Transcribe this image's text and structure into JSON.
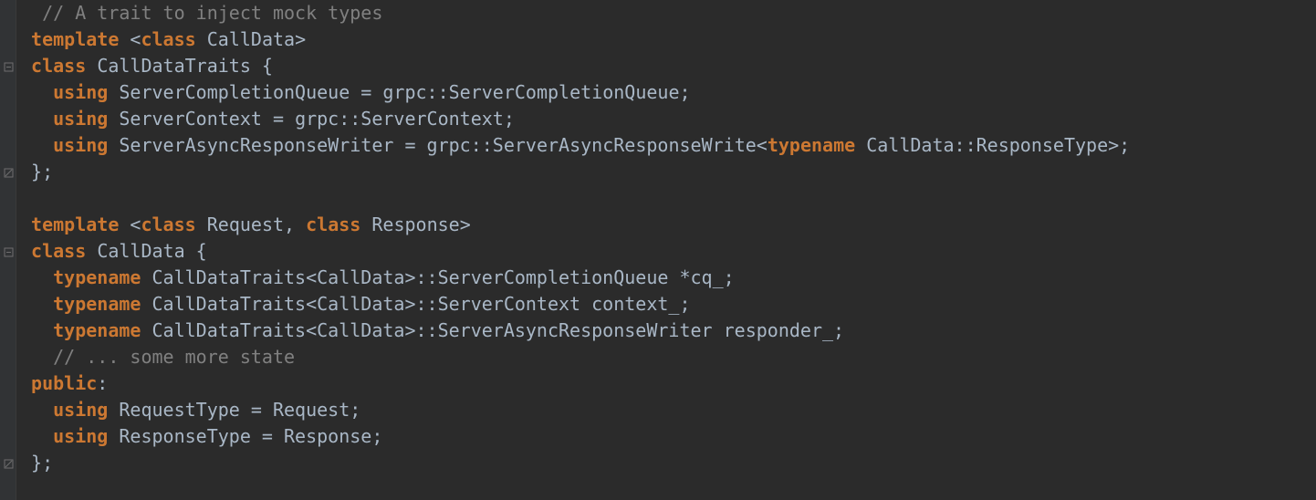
{
  "code": {
    "lines": [
      {
        "fold": null,
        "tokens": [
          {
            "cls": "tok-punct",
            "t": "  "
          },
          {
            "cls": "tok-comment",
            "t": "// A trait to inject mock types"
          }
        ]
      },
      {
        "fold": null,
        "tokens": [
          {
            "cls": "tok-punct",
            "t": " "
          },
          {
            "cls": "tok-keyword",
            "t": "template"
          },
          {
            "cls": "tok-punct",
            "t": " <"
          },
          {
            "cls": "tok-keyword",
            "t": "class"
          },
          {
            "cls": "tok-punct",
            "t": " "
          },
          {
            "cls": "tok-ident",
            "t": "CallData"
          },
          {
            "cls": "tok-punct",
            "t": ">"
          }
        ]
      },
      {
        "fold": "open",
        "tokens": [
          {
            "cls": "tok-punct",
            "t": " "
          },
          {
            "cls": "tok-keyword",
            "t": "class"
          },
          {
            "cls": "tok-punct",
            "t": " "
          },
          {
            "cls": "tok-ident",
            "t": "CallDataTraits"
          },
          {
            "cls": "tok-punct",
            "t": " {"
          }
        ]
      },
      {
        "fold": null,
        "tokens": [
          {
            "cls": "tok-punct",
            "t": "   "
          },
          {
            "cls": "tok-keyword",
            "t": "using"
          },
          {
            "cls": "tok-punct",
            "t": " "
          },
          {
            "cls": "tok-ident",
            "t": "ServerCompletionQueue"
          },
          {
            "cls": "tok-punct",
            "t": " = "
          },
          {
            "cls": "tok-ident",
            "t": "grpc::ServerCompletionQueue"
          },
          {
            "cls": "tok-punct",
            "t": ";"
          }
        ]
      },
      {
        "fold": null,
        "tokens": [
          {
            "cls": "tok-punct",
            "t": "   "
          },
          {
            "cls": "tok-keyword",
            "t": "using"
          },
          {
            "cls": "tok-punct",
            "t": " "
          },
          {
            "cls": "tok-ident",
            "t": "ServerContext"
          },
          {
            "cls": "tok-punct",
            "t": " = "
          },
          {
            "cls": "tok-ident",
            "t": "grpc::ServerContext"
          },
          {
            "cls": "tok-punct",
            "t": ";"
          }
        ]
      },
      {
        "fold": null,
        "tokens": [
          {
            "cls": "tok-punct",
            "t": "   "
          },
          {
            "cls": "tok-keyword",
            "t": "using"
          },
          {
            "cls": "tok-punct",
            "t": " "
          },
          {
            "cls": "tok-ident",
            "t": "ServerAsyncResponseWriter"
          },
          {
            "cls": "tok-punct",
            "t": " = "
          },
          {
            "cls": "tok-ident",
            "t": "grpc::ServerAsyncResponseWrite"
          },
          {
            "cls": "tok-punct",
            "t": "<"
          },
          {
            "cls": "tok-bkeyword",
            "t": "typename"
          },
          {
            "cls": "tok-punct",
            "t": " "
          },
          {
            "cls": "tok-ident",
            "t": "CallData::ResponseType"
          },
          {
            "cls": "tok-punct",
            "t": ">;"
          }
        ]
      },
      {
        "fold": "close",
        "tokens": [
          {
            "cls": "tok-punct",
            "t": " };"
          }
        ]
      },
      {
        "fold": null,
        "tokens": [
          {
            "cls": "tok-punct",
            "t": ""
          }
        ]
      },
      {
        "fold": null,
        "tokens": [
          {
            "cls": "tok-punct",
            "t": " "
          },
          {
            "cls": "tok-keyword",
            "t": "template"
          },
          {
            "cls": "tok-punct",
            "t": " <"
          },
          {
            "cls": "tok-keyword",
            "t": "class"
          },
          {
            "cls": "tok-punct",
            "t": " "
          },
          {
            "cls": "tok-ident",
            "t": "Request"
          },
          {
            "cls": "tok-punct",
            "t": ", "
          },
          {
            "cls": "tok-keyword",
            "t": "class"
          },
          {
            "cls": "tok-punct",
            "t": " "
          },
          {
            "cls": "tok-ident",
            "t": "Response"
          },
          {
            "cls": "tok-punct",
            "t": ">"
          }
        ]
      },
      {
        "fold": "open",
        "tokens": [
          {
            "cls": "tok-punct",
            "t": " "
          },
          {
            "cls": "tok-keyword",
            "t": "class"
          },
          {
            "cls": "tok-punct",
            "t": " "
          },
          {
            "cls": "tok-ident",
            "t": "CallData"
          },
          {
            "cls": "tok-punct",
            "t": " {"
          }
        ]
      },
      {
        "fold": null,
        "tokens": [
          {
            "cls": "tok-punct",
            "t": "   "
          },
          {
            "cls": "tok-keyword",
            "t": "typename"
          },
          {
            "cls": "tok-punct",
            "t": " "
          },
          {
            "cls": "tok-ident",
            "t": "CallDataTraits<CallData>::ServerCompletionQueue *cq_"
          },
          {
            "cls": "tok-punct",
            "t": ";"
          }
        ]
      },
      {
        "fold": null,
        "tokens": [
          {
            "cls": "tok-punct",
            "t": "   "
          },
          {
            "cls": "tok-keyword",
            "t": "typename"
          },
          {
            "cls": "tok-punct",
            "t": " "
          },
          {
            "cls": "tok-ident",
            "t": "CallDataTraits<CallData>::ServerContext context_"
          },
          {
            "cls": "tok-punct",
            "t": ";"
          }
        ]
      },
      {
        "fold": null,
        "tokens": [
          {
            "cls": "tok-punct",
            "t": "   "
          },
          {
            "cls": "tok-keyword",
            "t": "typename"
          },
          {
            "cls": "tok-punct",
            "t": " "
          },
          {
            "cls": "tok-ident",
            "t": "CallDataTraits<CallData>::ServerAsyncResponseWriter responder_"
          },
          {
            "cls": "tok-punct",
            "t": ";"
          }
        ]
      },
      {
        "fold": null,
        "tokens": [
          {
            "cls": "tok-punct",
            "t": "   "
          },
          {
            "cls": "tok-comment",
            "t": "// ... some more state"
          }
        ]
      },
      {
        "fold": null,
        "tokens": [
          {
            "cls": "tok-punct",
            "t": " "
          },
          {
            "cls": "tok-keyword",
            "t": "public"
          },
          {
            "cls": "tok-punct",
            "t": ":"
          }
        ]
      },
      {
        "fold": null,
        "tokens": [
          {
            "cls": "tok-punct",
            "t": "   "
          },
          {
            "cls": "tok-keyword",
            "t": "using"
          },
          {
            "cls": "tok-punct",
            "t": " "
          },
          {
            "cls": "tok-ident",
            "t": "RequestType"
          },
          {
            "cls": "tok-punct",
            "t": " = "
          },
          {
            "cls": "tok-ident",
            "t": "Request"
          },
          {
            "cls": "tok-punct",
            "t": ";"
          }
        ]
      },
      {
        "fold": null,
        "tokens": [
          {
            "cls": "tok-punct",
            "t": "   "
          },
          {
            "cls": "tok-keyword",
            "t": "using"
          },
          {
            "cls": "tok-punct",
            "t": " "
          },
          {
            "cls": "tok-ident",
            "t": "ResponseType"
          },
          {
            "cls": "tok-punct",
            "t": " = "
          },
          {
            "cls": "tok-ident",
            "t": "Response"
          },
          {
            "cls": "tok-punct",
            "t": ";"
          }
        ]
      },
      {
        "fold": "close",
        "tokens": [
          {
            "cls": "tok-punct",
            "t": " };"
          }
        ]
      }
    ]
  },
  "icons": {
    "fold_open_title": "collapse block",
    "fold_close_title": "end of block"
  }
}
